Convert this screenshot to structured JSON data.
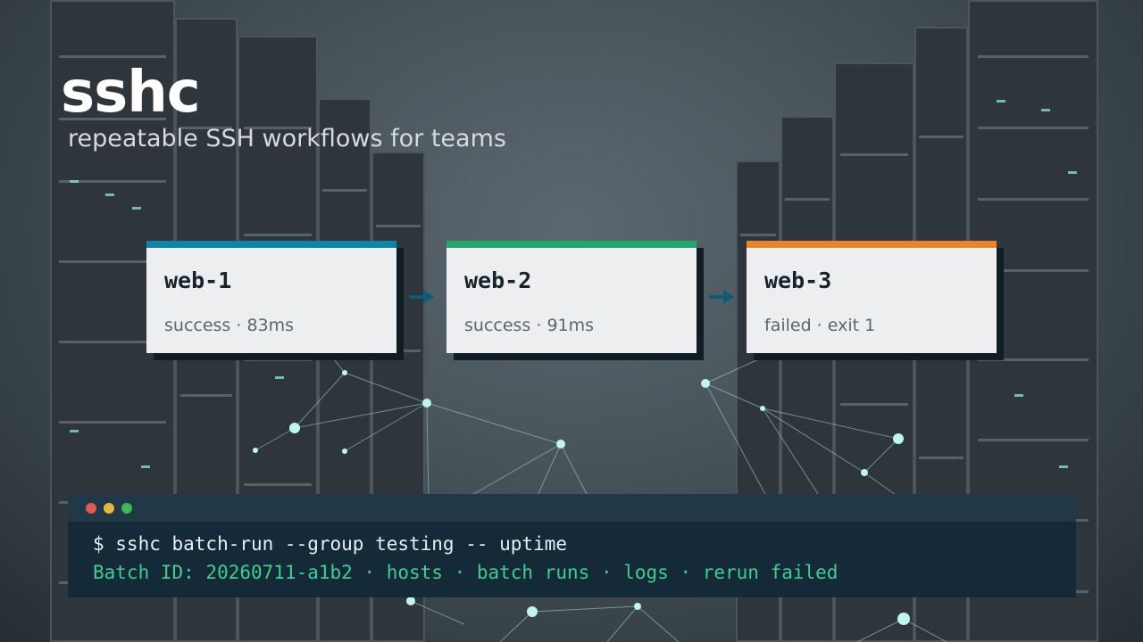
{
  "header": {
    "title": "sshc",
    "subtitle": "repeatable SSH workflows for teams"
  },
  "hosts": [
    {
      "name": "web-1",
      "status": "success · 83ms",
      "color": "#0e86a8"
    },
    {
      "name": "web-2",
      "status": "success · 91ms",
      "color": "#22a86a"
    },
    {
      "name": "web-3",
      "status": "failed · exit 1",
      "color": "#e8842a"
    }
  ],
  "terminal": {
    "command": "$ sshc batch-run --group testing -- uptime",
    "output": "Batch ID: 20260711-a1b2 · hosts · batch runs · logs · rerun failed",
    "dots": [
      "#e05a4e",
      "#e2b93b",
      "#3fb950"
    ]
  },
  "colors": {
    "arrow": "#0b5d73",
    "card_shadow": "#0f1d24"
  }
}
